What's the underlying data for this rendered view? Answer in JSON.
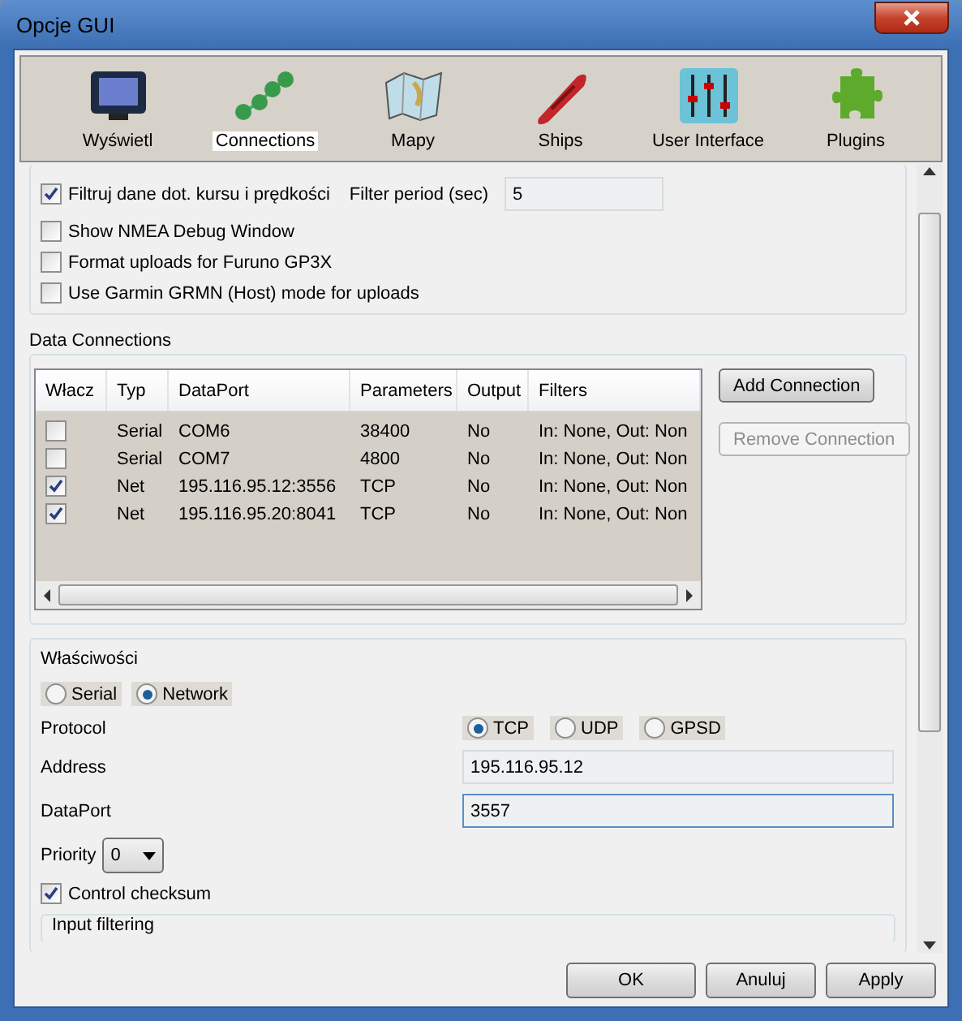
{
  "window": {
    "title": "Opcje GUI"
  },
  "tabs": [
    {
      "label": "Wyświetl",
      "kind": "monitor",
      "selected": false
    },
    {
      "label": "Connections",
      "kind": "network",
      "selected": true
    },
    {
      "label": "Mapy",
      "kind": "map",
      "selected": false
    },
    {
      "label": "Ships",
      "kind": "ship",
      "selected": false
    },
    {
      "label": "User Interface",
      "kind": "sliders",
      "selected": false
    },
    {
      "label": "Plugins",
      "kind": "puzzle",
      "selected": false
    }
  ],
  "general": {
    "filter": {
      "label": "Filtruj dane dot. kursu i prędkości",
      "checked": true,
      "period_label": "Filter period (sec)",
      "period_value": "5"
    },
    "options": [
      {
        "label": "Show NMEA Debug Window",
        "checked": false
      },
      {
        "label": "Format uploads for Furuno GP3X",
        "checked": false
      },
      {
        "label": "Use Garmin GRMN (Host) mode for uploads",
        "checked": false
      }
    ]
  },
  "data_connections": {
    "title": "Data Connections",
    "check_column": "Włacz",
    "columns": [
      "Typ",
      "DataPort",
      "Parameters",
      "Output",
      "Filters"
    ],
    "rows": [
      {
        "checked": false,
        "cells": [
          "Serial",
          "COM6",
          "38400",
          "No",
          "In: None, Out: Non"
        ]
      },
      {
        "checked": false,
        "cells": [
          "Serial",
          "COM7",
          "4800",
          "No",
          "In: None, Out: Non"
        ]
      },
      {
        "checked": true,
        "cells": [
          "Net",
          "195.116.95.12:3556",
          "TCP",
          "No",
          "In: None, Out: Non"
        ]
      },
      {
        "checked": true,
        "cells": [
          "Net",
          "195.116.95.20:8041",
          "TCP",
          "No",
          "In: None, Out: Non"
        ]
      }
    ],
    "buttons": [
      {
        "label": "Add Connection",
        "disabled": false
      },
      {
        "label": "Remove Connection",
        "disabled": true
      }
    ]
  },
  "properties": {
    "title": "Właściwości",
    "types": [
      {
        "label": "Serial",
        "selected": false
      },
      {
        "label": "Network",
        "selected": true
      }
    ],
    "protocol": {
      "label": "Protocol",
      "options": [
        {
          "label": "TCP",
          "selected": true
        },
        {
          "label": "UDP",
          "selected": false
        },
        {
          "label": "GPSD",
          "selected": false
        }
      ]
    },
    "address": {
      "label": "Address",
      "value": "195.116.95.12"
    },
    "dataport": {
      "label": "DataPort",
      "value": "3557",
      "focused": true
    },
    "priority": {
      "label": "Priority",
      "value": "0"
    },
    "checksum": {
      "label": "Control checksum",
      "checked": true
    },
    "input_filtering": {
      "title": "Input filtering"
    }
  },
  "footer": [
    "OK",
    "Anuluj",
    "Apply"
  ]
}
